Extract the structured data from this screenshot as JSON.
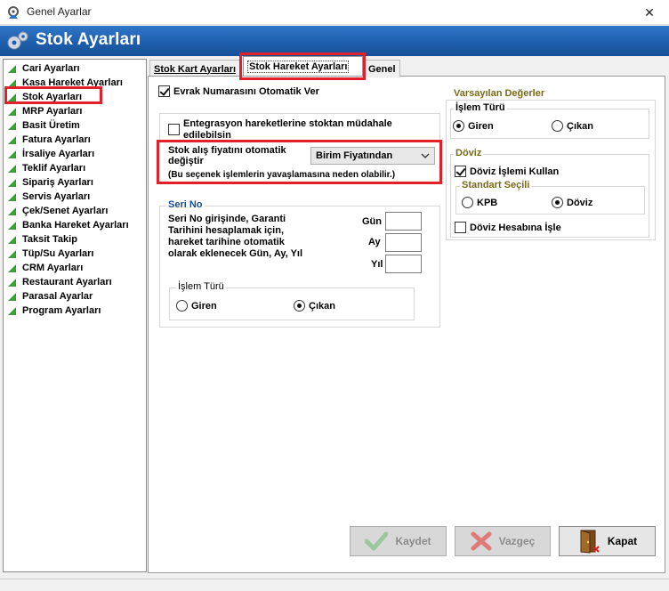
{
  "window": {
    "title": "Genel Ayarlar",
    "close_glyph": "✕"
  },
  "header": {
    "title": "Stok Ayarları"
  },
  "sidebar": {
    "items": [
      "Cari Ayarları",
      "Kasa Hareket Ayarları",
      "Stok Ayarları",
      "MRP Ayarları",
      "Basit Üretim",
      "Fatura Ayarları",
      "İrsaliye Ayarları",
      "Teklif Ayarları",
      "Sipariş Ayarları",
      "Servis Ayarları",
      "Çek/Senet Ayarları",
      "Banka Hareket Ayarları",
      "Taksit Takip",
      "Tüp/Su Ayarları",
      "CRM Ayarları",
      "Restaurant Ayarları",
      "Parasal Ayarlar",
      "Program Ayarları"
    ],
    "selected": "Stok Ayarları"
  },
  "tabs": {
    "stok_kart": "Stok Kart Ayarları",
    "stok_hareket": "Stok Hareket Ayarları",
    "genel": "Genel",
    "active": "Stok Hareket Ayarları"
  },
  "settings": {
    "evrak_numarasi": {
      "label": "Evrak Numarasını Otomatik Ver",
      "checked": true
    },
    "entegrasyon": {
      "label_line1": "Entegrasyon hareketlerine stoktan müdahale",
      "label_line2": "edilebilsin",
      "checked": false
    },
    "stok_alis": {
      "label_line1": "Stok alış fiyatını otomatik",
      "label_line2": "değiştir",
      "selected": "Birim Fiyatından",
      "warning": "(Bu seçenek işlemlerin yavaşlamasına neden olabilir.)"
    }
  },
  "seri_no": {
    "legend": "Seri No",
    "description_lines": [
      "Seri No girişinde, Garanti",
      "Tarihini hesaplamak için,",
      "hareket tarihine otomatik",
      "olarak eklenecek Gün, Ay, Yıl"
    ],
    "gun_label": "Gün",
    "gun_value": "",
    "ay_label": "Ay",
    "ay_value": "",
    "yil_label": "Yıl",
    "yil_value": "",
    "islem_turu": {
      "legend": "İşlem Türü",
      "giren": "Giren",
      "cikan": "Çıkan",
      "selected": "Çıkan"
    }
  },
  "varsayilan": {
    "legend": "Varsayılan Değerler",
    "islem_turu": {
      "legend": "İşlem Türü",
      "giren": "Giren",
      "cikan": "Çıkan",
      "selected": "Giren"
    },
    "doviz": {
      "legend": "Döviz",
      "doviz_islemi_kullan": {
        "label": "Döviz İşlemi Kullan",
        "checked": true
      },
      "standart_secili": {
        "legend": "Standart Seçili",
        "kpb": "KPB",
        "doviz": "Döviz",
        "selected": "Döviz"
      },
      "doviz_hesabina_isle": {
        "label": "Döviz Hesabına İşle",
        "checked": false
      }
    }
  },
  "buttons": {
    "kaydet": "Kaydet",
    "vazgec": "Vazgeç",
    "kapat": "Kapat"
  },
  "colors": {
    "highlight": "#e0202a",
    "header": "#1f5fae",
    "legend_olive": "#7a6a1a",
    "legend_blue": "#1a4a9c",
    "tree_green": "#3aa03a"
  }
}
